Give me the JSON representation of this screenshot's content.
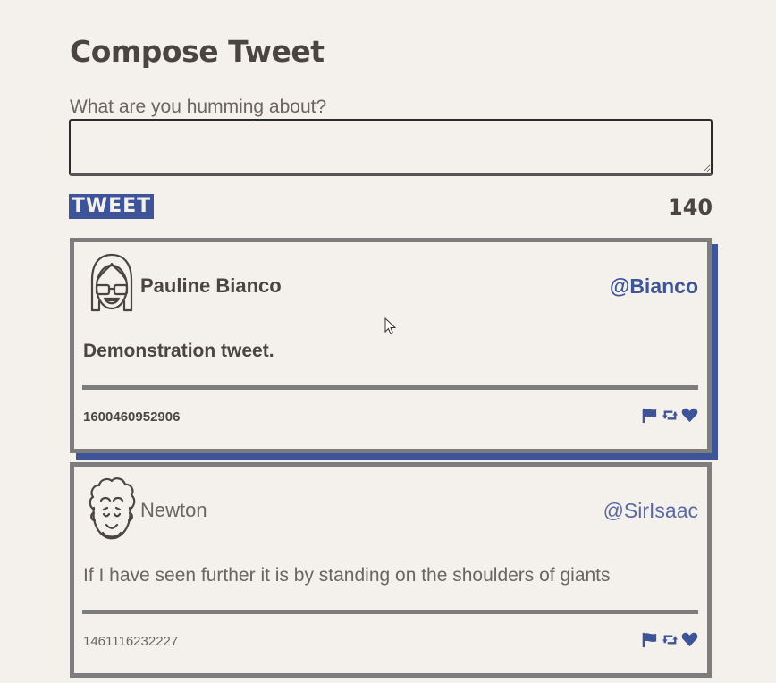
{
  "page": {
    "title": "Compose Tweet"
  },
  "compose": {
    "label": "What are you humming about?",
    "value": "",
    "button_label": "TWEET",
    "counter": "140"
  },
  "colors": {
    "accent": "#3e5498",
    "border": "#7d7d7d",
    "background": "#f4f1ec",
    "text": "#4a4540"
  },
  "tweets": [
    {
      "avatar_icon": "woman-with-glasses-avatar-icon",
      "name": "Pauline Bianco",
      "handle": "@Bianco",
      "text": "Demonstration tweet.",
      "timestamp": "1600460952906",
      "actions": [
        "flag-icon",
        "retweet-icon",
        "heart-icon"
      ]
    },
    {
      "avatar_icon": "curly-haired-man-avatar-icon",
      "name": "Newton",
      "handle": "@SirIsaac",
      "text": "If I have seen further it is by standing on the shoulders of giants",
      "timestamp": "1461116232227",
      "actions": [
        "flag-icon",
        "retweet-icon",
        "heart-icon"
      ]
    }
  ]
}
